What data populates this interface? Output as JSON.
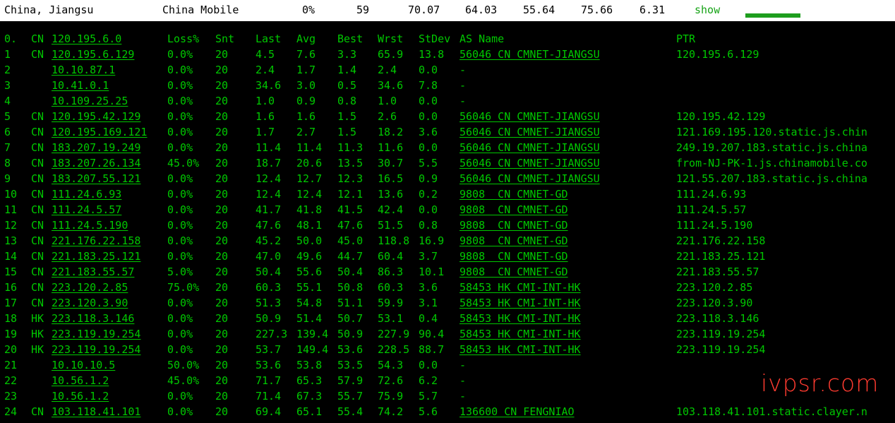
{
  "topbar": {
    "location": "China, Jiangsu",
    "isp": "China Mobile",
    "loss": "0%",
    "snt": "59",
    "last": "70.07",
    "avg": "64.03",
    "best": "55.64",
    "wrst": "75.66",
    "stdev": "6.31",
    "show_label": "show"
  },
  "header": {
    "hop": "0.",
    "cc": "CN",
    "host": "120.195.6.0",
    "loss": "Loss%",
    "snt": "Snt",
    "last": "Last",
    "avg": "Avg",
    "best": "Best",
    "wrst": "Wrst",
    "stdev": "StDev",
    "asname": "AS Name",
    "ptr": "PTR"
  },
  "hops": [
    {
      "hop": "1",
      "cc": "CN",
      "host": "120.195.6.129",
      "loss": "0.0%",
      "snt": "20",
      "last": "4.5",
      "avg": "7.6",
      "best": "3.3",
      "wrst": "65.9",
      "stdev": "13.8",
      "asname": "56046 CN CMNET-JIANGSU",
      "ptr": "120.195.6.129"
    },
    {
      "hop": "2",
      "cc": "",
      "host": "10.10.87.1",
      "loss": "0.0%",
      "snt": "20",
      "last": "2.4",
      "avg": "1.7",
      "best": "1.4",
      "wrst": "2.4",
      "stdev": "0.0",
      "asname": "-",
      "ptr": ""
    },
    {
      "hop": "3",
      "cc": "",
      "host": "10.41.0.1",
      "loss": "0.0%",
      "snt": "20",
      "last": "34.6",
      "avg": "3.0",
      "best": "0.5",
      "wrst": "34.6",
      "stdev": "7.8",
      "asname": "-",
      "ptr": ""
    },
    {
      "hop": "4",
      "cc": "",
      "host": "10.109.25.25",
      "loss": "0.0%",
      "snt": "20",
      "last": "1.0",
      "avg": "0.9",
      "best": "0.8",
      "wrst": "1.0",
      "stdev": "0.0",
      "asname": "-",
      "ptr": ""
    },
    {
      "hop": "5",
      "cc": "CN",
      "host": "120.195.42.129",
      "loss": "0.0%",
      "snt": "20",
      "last": "1.6",
      "avg": "1.6",
      "best": "1.5",
      "wrst": "2.6",
      "stdev": "0.0",
      "asname": "56046 CN CMNET-JIANGSU",
      "ptr": "120.195.42.129"
    },
    {
      "hop": "6",
      "cc": "CN",
      "host": "120.195.169.121",
      "loss": "0.0%",
      "snt": "20",
      "last": "1.7",
      "avg": "2.7",
      "best": "1.5",
      "wrst": "18.2",
      "stdev": "3.6",
      "asname": "56046 CN CMNET-JIANGSU",
      "ptr": "121.169.195.120.static.js.chin"
    },
    {
      "hop": "7",
      "cc": "CN",
      "host": "183.207.19.249",
      "loss": "0.0%",
      "snt": "20",
      "last": "11.4",
      "avg": "11.4",
      "best": "11.3",
      "wrst": "11.6",
      "stdev": "0.0",
      "asname": "56046 CN CMNET-JIANGSU",
      "ptr": "249.19.207.183.static.js.china"
    },
    {
      "hop": "8",
      "cc": "CN",
      "host": "183.207.26.134",
      "loss": "45.0%",
      "snt": "20",
      "last": "18.7",
      "avg": "20.6",
      "best": "13.5",
      "wrst": "30.7",
      "stdev": "5.5",
      "asname": "56046 CN CMNET-JIANGSU",
      "ptr": "from-NJ-PK-1.js.chinamobile.co"
    },
    {
      "hop": "9",
      "cc": "CN",
      "host": "183.207.55.121",
      "loss": "0.0%",
      "snt": "20",
      "last": "12.4",
      "avg": "12.7",
      "best": "12.3",
      "wrst": "16.5",
      "stdev": "0.9",
      "asname": "56046 CN CMNET-JIANGSU",
      "ptr": "121.55.207.183.static.js.china"
    },
    {
      "hop": "10",
      "cc": "CN",
      "host": "111.24.6.93",
      "loss": "0.0%",
      "snt": "20",
      "last": "12.4",
      "avg": "12.4",
      "best": "12.1",
      "wrst": "13.6",
      "stdev": "0.2",
      "asname": "9808  CN CMNET-GD",
      "ptr": "111.24.6.93"
    },
    {
      "hop": "11",
      "cc": "CN",
      "host": "111.24.5.57",
      "loss": "0.0%",
      "snt": "20",
      "last": "41.7",
      "avg": "41.8",
      "best": "41.5",
      "wrst": "42.4",
      "stdev": "0.0",
      "asname": "9808  CN CMNET-GD",
      "ptr": "111.24.5.57"
    },
    {
      "hop": "12",
      "cc": "CN",
      "host": "111.24.5.190",
      "loss": "0.0%",
      "snt": "20",
      "last": "47.6",
      "avg": "48.1",
      "best": "47.6",
      "wrst": "51.5",
      "stdev": "0.8",
      "asname": "9808  CN CMNET-GD",
      "ptr": "111.24.5.190"
    },
    {
      "hop": "13",
      "cc": "CN",
      "host": "221.176.22.158",
      "loss": "0.0%",
      "snt": "20",
      "last": "45.2",
      "avg": "50.0",
      "best": "45.0",
      "wrst": "118.8",
      "stdev": "16.9",
      "asname": "9808  CN CMNET-GD",
      "ptr": "221.176.22.158"
    },
    {
      "hop": "14",
      "cc": "CN",
      "host": "221.183.25.121",
      "loss": "0.0%",
      "snt": "20",
      "last": "47.0",
      "avg": "49.6",
      "best": "44.7",
      "wrst": "60.4",
      "stdev": "3.7",
      "asname": "9808  CN CMNET-GD",
      "ptr": "221.183.25.121"
    },
    {
      "hop": "15",
      "cc": "CN",
      "host": "221.183.55.57",
      "loss": "5.0%",
      "snt": "20",
      "last": "50.4",
      "avg": "55.6",
      "best": "50.4",
      "wrst": "86.3",
      "stdev": "10.1",
      "asname": "9808  CN CMNET-GD",
      "ptr": "221.183.55.57"
    },
    {
      "hop": "16",
      "cc": "CN",
      "host": "223.120.2.85",
      "loss": "75.0%",
      "snt": "20",
      "last": "60.3",
      "avg": "55.1",
      "best": "50.8",
      "wrst": "60.3",
      "stdev": "3.6",
      "asname": "58453 HK CMI-INT-HK",
      "ptr": "223.120.2.85"
    },
    {
      "hop": "17",
      "cc": "CN",
      "host": "223.120.3.90",
      "loss": "0.0%",
      "snt": "20",
      "last": "51.3",
      "avg": "54.8",
      "best": "51.1",
      "wrst": "59.9",
      "stdev": "3.1",
      "asname": "58453 HK CMI-INT-HK",
      "ptr": "223.120.3.90"
    },
    {
      "hop": "18",
      "cc": "HK",
      "host": "223.118.3.146",
      "loss": "0.0%",
      "snt": "20",
      "last": "50.9",
      "avg": "51.4",
      "best": "50.7",
      "wrst": "53.1",
      "stdev": "0.4",
      "asname": "58453 HK CMI-INT-HK",
      "ptr": "223.118.3.146"
    },
    {
      "hop": "19",
      "cc": "HK",
      "host": "223.119.19.254",
      "loss": "0.0%",
      "snt": "20",
      "last": "227.3",
      "avg": "139.4",
      "best": "50.9",
      "wrst": "227.9",
      "stdev": "90.4",
      "asname": "58453 HK CMI-INT-HK",
      "ptr": "223.119.19.254"
    },
    {
      "hop": "20",
      "cc": "HK",
      "host": "223.119.19.254",
      "loss": "0.0%",
      "snt": "20",
      "last": "53.7",
      "avg": "149.4",
      "best": "53.6",
      "wrst": "228.5",
      "stdev": "88.7",
      "asname": "58453 HK CMI-INT-HK",
      "ptr": "223.119.19.254"
    },
    {
      "hop": "21",
      "cc": "",
      "host": "10.10.10.5",
      "loss": "50.0%",
      "snt": "20",
      "last": "53.6",
      "avg": "53.8",
      "best": "53.5",
      "wrst": "54.3",
      "stdev": "0.0",
      "asname": "-",
      "ptr": ""
    },
    {
      "hop": "22",
      "cc": "",
      "host": "10.56.1.2",
      "loss": "45.0%",
      "snt": "20",
      "last": "71.7",
      "avg": "65.3",
      "best": "57.9",
      "wrst": "72.6",
      "stdev": "6.2",
      "asname": "-",
      "ptr": ""
    },
    {
      "hop": "23",
      "cc": "",
      "host": "10.56.1.2",
      "loss": "0.0%",
      "snt": "20",
      "last": "71.4",
      "avg": "67.3",
      "best": "55.7",
      "wrst": "75.9",
      "stdev": "5.7",
      "asname": "-",
      "ptr": ""
    },
    {
      "hop": "24",
      "cc": "CN",
      "host": "103.118.41.101",
      "loss": "0.0%",
      "snt": "20",
      "last": "69.4",
      "avg": "65.1",
      "best": "55.4",
      "wrst": "74.2",
      "stdev": "5.6",
      "asname": "136600 CN FENGNIAO",
      "ptr": "103.118.41.101.static.clayer.n"
    }
  ],
  "watermark": "ivpsr.com",
  "colors": {
    "text": "#00c800",
    "background": "#000000",
    "topbar": "#ffffff",
    "watermark": "#ff3b30"
  }
}
